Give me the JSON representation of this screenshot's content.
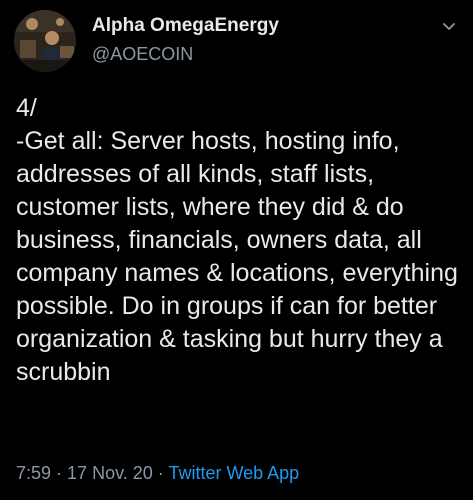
{
  "author": {
    "display_name": "Alpha OmegaEnergy",
    "handle": "@AOECOIN"
  },
  "icons": {
    "avatar": "profile-photo",
    "menu": "chevron-down-icon"
  },
  "tweet": {
    "text": "4/\n-Get all: Server hosts, hosting info, addresses of all kinds, staff lists, customer lists, where they did & do business, financials, owners data, all company names & locations, everything possible. Do in groups if can for better organization & tasking but hurry they a scrubbin"
  },
  "meta": {
    "time": "7:59",
    "separator": " · ",
    "date": "17 Nov. 20",
    "source": "Twitter Web App"
  },
  "colors": {
    "background": "#000000",
    "text": "#e7e9ea",
    "secondary": "#8b98a5",
    "link": "#1d9bf0"
  }
}
